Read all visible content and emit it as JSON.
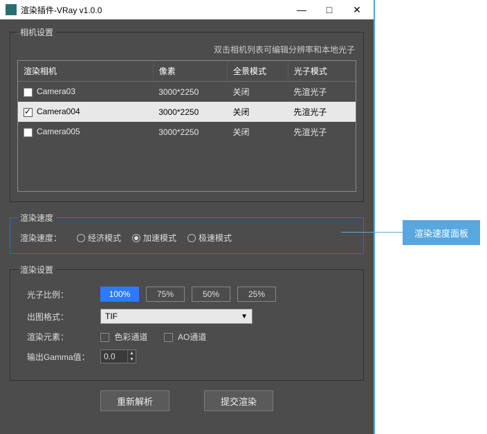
{
  "titlebar": {
    "title": "渲染插件-VRay v1.0.0"
  },
  "camera_panel": {
    "legend": "相机设置",
    "hint": "双击相机列表可编辑分辨率和本地光子",
    "headers": {
      "name": "渲染相机",
      "pixels": "像素",
      "pano": "全景模式",
      "photon": "光子模式"
    },
    "rows": [
      {
        "checked": false,
        "name": "Camera03",
        "pixels": "3000*2250",
        "pano": "关闭",
        "photon": "先渲光子",
        "selected": false
      },
      {
        "checked": true,
        "name": "Camera004",
        "pixels": "3000*2250",
        "pano": "关闭",
        "photon": "先渲光子",
        "selected": true
      },
      {
        "checked": false,
        "name": "Camera005",
        "pixels": "3000*2250",
        "pano": "关闭",
        "photon": "先渲光子",
        "selected": false
      }
    ]
  },
  "speed_panel": {
    "legend": "渲染速度",
    "label": "渲染速度：",
    "options": {
      "eco": "经济模式",
      "accel": "加速模式",
      "turbo": "极速模式"
    },
    "selected": "accel"
  },
  "settings_panel": {
    "legend": "渲染设置",
    "photon_ratio_label": "光子比例：",
    "ratios": {
      "r100": "100%",
      "r75": "75%",
      "r50": "50%",
      "r25": "25%"
    },
    "ratio_active": "r100",
    "format_label": "出图格式：",
    "format_value": "TIF",
    "elements_label": "渲染元素：",
    "color_channel_label": "色彩通道",
    "ao_channel_label": "AO通道",
    "gamma_label": "输出Gamma值：",
    "gamma_value": "0.0"
  },
  "buttons": {
    "reparse": "重新解析",
    "submit": "提交渲染"
  },
  "callout": {
    "label": "渲染速度面板"
  }
}
